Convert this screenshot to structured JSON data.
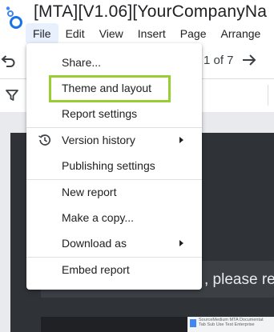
{
  "header": {
    "title": "[MTA][V1.06][YourCompanyNa",
    "menus": [
      {
        "label": "File"
      },
      {
        "label": "Edit"
      },
      {
        "label": "View"
      },
      {
        "label": "Insert"
      },
      {
        "label": "Page"
      },
      {
        "label": "Arrange"
      }
    ]
  },
  "toolbar": {
    "page_counter": "1 of 7"
  },
  "file_menu": {
    "items": [
      {
        "label": "Share..."
      },
      {
        "label": "Theme and layout",
        "highlight_color": "#9acd32"
      },
      {
        "label": "Report settings"
      },
      {
        "label": "Version history",
        "icon": "history-icon",
        "has_submenu": true
      },
      {
        "label": "Publishing settings"
      },
      {
        "label": "New report"
      },
      {
        "label": "Make a copy..."
      },
      {
        "label": "Download as",
        "has_submenu": true
      },
      {
        "label": "Embed report"
      }
    ]
  },
  "report": {
    "partial_text": ", please re",
    "thumbnail_lines": [
      "SourceMedium MTA Documentat",
      "Tab   Sub   Use   Test   Enterprise"
    ]
  },
  "colors": {
    "accent": "#1a73e8",
    "menu_active_bg": "#e8f0fe",
    "highlight": "#9acd32",
    "report_dark": "#2f3237"
  }
}
